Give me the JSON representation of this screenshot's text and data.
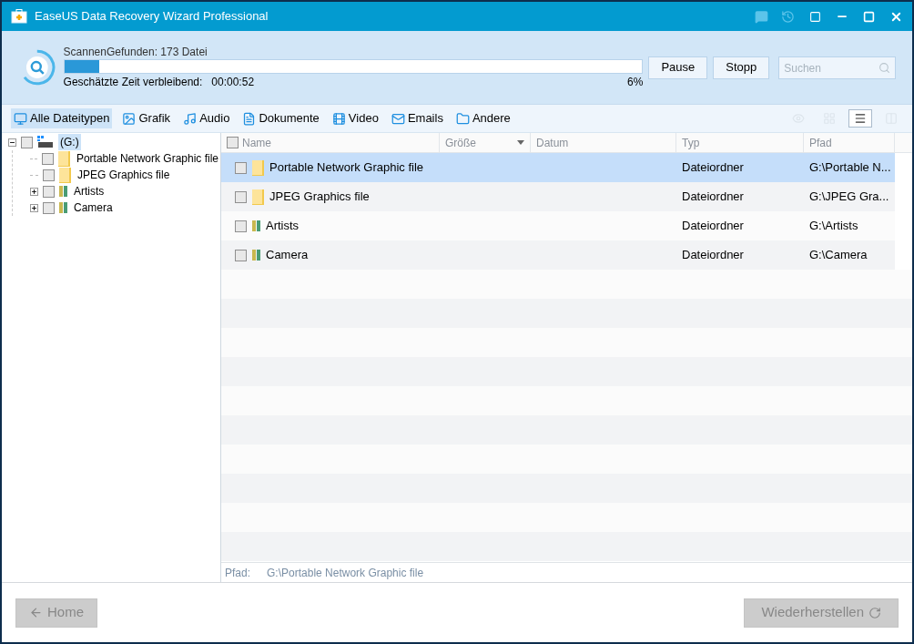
{
  "window": {
    "title": "EaseUS Data Recovery Wizard Professional"
  },
  "scan": {
    "label": "ScannenGefunden: 173 Datei",
    "level": 0.06,
    "percent": "6%",
    "time_label": "Geschätzte Zeit verbleibend:",
    "time": "00:00:52"
  },
  "scan_buttons": [
    "Pause",
    "Stopp"
  ],
  "search": {
    "placeholder": "Suchen"
  },
  "filters": [
    {
      "label": "Alle Dateitypen",
      "kind": "all",
      "selected": true
    },
    {
      "label": "Grafik",
      "kind": "image",
      "selected": false
    },
    {
      "label": "Audio",
      "kind": "audio",
      "selected": false
    },
    {
      "label": "Dokumente",
      "kind": "document",
      "selected": false
    },
    {
      "label": "Video",
      "kind": "video",
      "selected": false
    },
    {
      "label": "Emails",
      "kind": "mail",
      "selected": false
    },
    {
      "label": "Andere",
      "kind": "other",
      "selected": false
    }
  ],
  "view_modes": [
    {
      "kind": "preview",
      "selected": false,
      "disabled": true
    },
    {
      "kind": "thumbnails",
      "selected": false,
      "disabled": true
    },
    {
      "kind": "list",
      "selected": true,
      "disabled": false
    },
    {
      "kind": "details",
      "selected": false,
      "disabled": true
    }
  ],
  "tree": [
    {
      "label": "(G:)",
      "kind": "drive",
      "expanded": true,
      "selected": true,
      "checked": false,
      "children": [
        {
          "label": "Portable Network Graphic file",
          "kind": "folder",
          "checked": false,
          "selected": false
        },
        {
          "label": "JPEG Graphics file",
          "kind": "folder",
          "checked": false,
          "selected": false
        },
        {
          "label": "Artists",
          "kind": "library",
          "checked": false,
          "selected": false,
          "expanded": false
        },
        {
          "label": "Camera",
          "kind": "library",
          "checked": false,
          "selected": false,
          "expanded": false
        }
      ]
    }
  ],
  "table": {
    "columns": [
      {
        "label": "Name",
        "sorted": false
      },
      {
        "label": "Größe",
        "sorted": true
      },
      {
        "label": "Datum",
        "sorted": false
      },
      {
        "label": "Typ",
        "sorted": false
      },
      {
        "label": "Pfad",
        "sorted": false
      }
    ],
    "rows": [
      {
        "name": "Portable Network Graphic file",
        "kind": "folder",
        "type": "Dateiordner",
        "path": "G:\\Portable N...",
        "selected": true,
        "checked": false
      },
      {
        "name": "JPEG Graphics file",
        "kind": "folder",
        "type": "Dateiordner",
        "path": "G:\\JPEG Gra...",
        "selected": false,
        "checked": false
      },
      {
        "name": "Artists",
        "kind": "library",
        "type": "Dateiordner",
        "path": "G:\\Artists",
        "selected": false,
        "checked": false
      },
      {
        "name": "Camera",
        "kind": "library",
        "type": "Dateiordner",
        "path": "G:\\Camera",
        "selected": false,
        "checked": false
      }
    ]
  },
  "status_bar": {
    "label": "Pfad:",
    "value": "G:\\Portable Network Graphic file"
  },
  "footer": {
    "back": {
      "label": "Home",
      "disabled": true
    },
    "recover": {
      "label": "Wiederherstellen",
      "disabled": true
    }
  }
}
